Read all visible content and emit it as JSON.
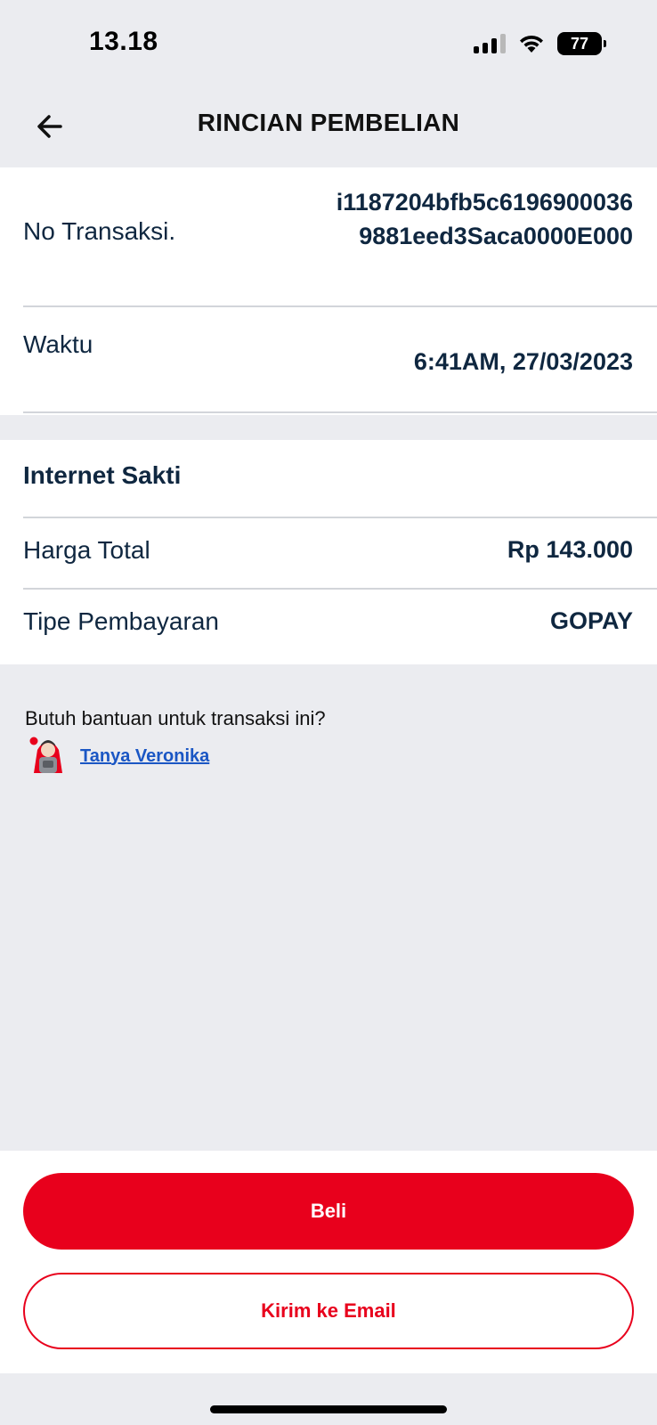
{
  "status_bar": {
    "time": "13.18",
    "battery": "77"
  },
  "header": {
    "title": "RINCIAN PEMBELIAN"
  },
  "transaction": {
    "id_label": "No Transaksi.",
    "id_value": "i1187204bfb5c61969000369881eed3Saca0000E000",
    "time_label": "Waktu",
    "time_value": "6:41AM, 27/03/2023"
  },
  "purchase": {
    "product_name": "Internet Sakti",
    "total_label": "Harga Total",
    "total_value": "Rp 143.000",
    "payment_label": "Tipe Pembayaran",
    "payment_value": "GOPAY"
  },
  "help": {
    "question": "Butuh bantuan untuk transaksi ini?",
    "link_label": "Tanya Veronika"
  },
  "actions": {
    "buy_label": "Beli",
    "email_label": "Kirim ke Email"
  },
  "colors": {
    "accent": "#e8001c",
    "text_dark": "#0f2740",
    "link": "#1a56c4",
    "background": "#ebecf0"
  }
}
